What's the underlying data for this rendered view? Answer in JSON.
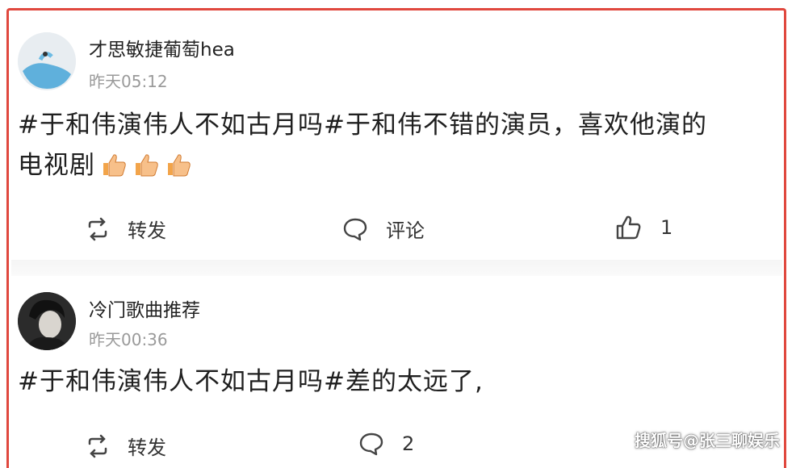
{
  "posts": [
    {
      "username": "才思敏捷葡萄hea",
      "time": "昨天05:12",
      "content_line1": "#于和伟演伟人不如古月吗#于和伟不错的演员，喜欢他演的",
      "content_line2": "电视剧",
      "emoji": [
        "thumbs-up",
        "thumbs-up",
        "thumbs-up"
      ],
      "actions": {
        "repost": "转发",
        "comment": "评论",
        "like_count": "1"
      }
    },
    {
      "username": "冷门歌曲推荐",
      "time": "昨天00:36",
      "content_line1": "#于和伟演伟人不如古月吗#差的太远了,",
      "actions": {
        "repost": "转发",
        "comment_count": "2"
      }
    }
  ],
  "watermark": "搜狐号@张三聊娱乐",
  "colors": {
    "frame": "#e0483e",
    "time": "#9a9a9a",
    "text": "#1f1f1f"
  }
}
